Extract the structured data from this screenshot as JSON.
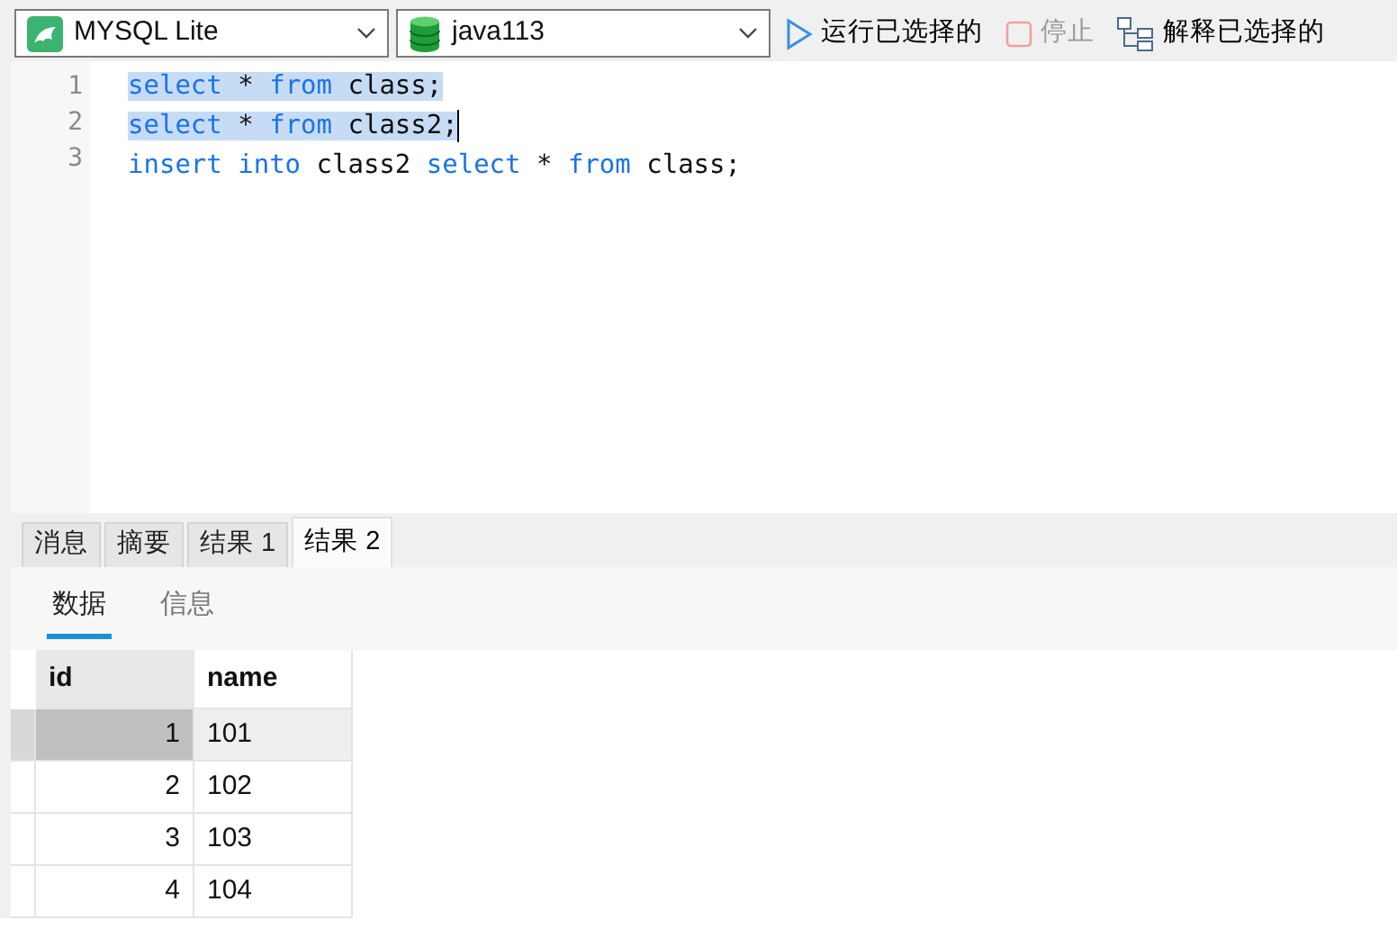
{
  "toolbar": {
    "connection": {
      "value": "MYSQL Lite"
    },
    "database": {
      "value": "java113"
    },
    "buttons": [
      {
        "kind": "run",
        "label": "运行已选择的",
        "disabled": false
      },
      {
        "kind": "stop",
        "label": "停止",
        "disabled": true
      },
      {
        "kind": "explain",
        "label": "解释已选择的",
        "disabled": false
      }
    ]
  },
  "editor": {
    "lines": [
      {
        "number": "1",
        "selected": true,
        "cursor": false,
        "tokens": [
          {
            "kind": "keyword",
            "text": "select"
          },
          {
            "kind": "plain",
            "text": " * "
          },
          {
            "kind": "keyword",
            "text": "from"
          },
          {
            "kind": "plain",
            "text": " class;"
          }
        ]
      },
      {
        "number": "2",
        "selected": true,
        "cursor": true,
        "tokens": [
          {
            "kind": "keyword",
            "text": "select"
          },
          {
            "kind": "plain",
            "text": " * "
          },
          {
            "kind": "keyword",
            "text": "from"
          },
          {
            "kind": "plain",
            "text": " class2;"
          }
        ]
      },
      {
        "number": "3",
        "selected": false,
        "cursor": false,
        "tokens": [
          {
            "kind": "keyword",
            "text": "insert into"
          },
          {
            "kind": "plain",
            "text": " class2 "
          },
          {
            "kind": "keyword",
            "text": "select"
          },
          {
            "kind": "plain",
            "text": " * "
          },
          {
            "kind": "keyword",
            "text": "from"
          },
          {
            "kind": "plain",
            "text": " class;"
          }
        ]
      }
    ]
  },
  "result_tabs": [
    {
      "label": "消息",
      "selected": false
    },
    {
      "label": "摘要",
      "selected": false
    },
    {
      "label": "结果 1",
      "selected": false
    },
    {
      "label": "结果 2",
      "selected": true
    }
  ],
  "sub_tabs": [
    {
      "label": "数据",
      "selected": true
    },
    {
      "label": "信息",
      "selected": false
    }
  ],
  "table": {
    "columns": [
      "id",
      "name"
    ],
    "rows": [
      {
        "cells": [
          "1",
          "101"
        ],
        "selected": true
      },
      {
        "cells": [
          "2",
          "102"
        ],
        "selected": false
      },
      {
        "cells": [
          "3",
          "103"
        ],
        "selected": false
      },
      {
        "cells": [
          "4",
          "104"
        ],
        "selected": false
      }
    ]
  }
}
